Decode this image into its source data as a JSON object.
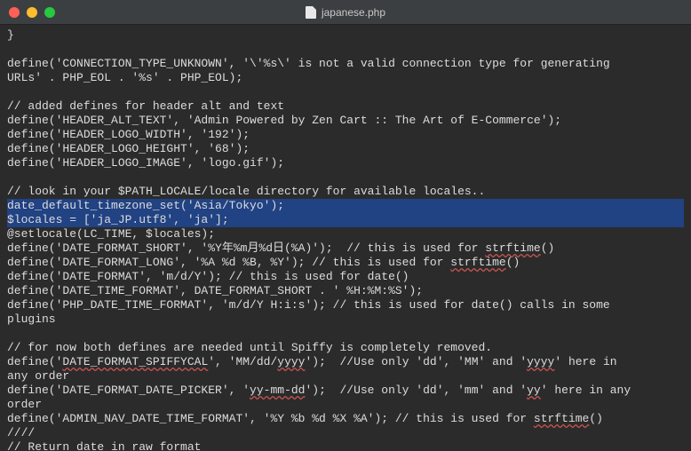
{
  "window": {
    "filename": "japanese.php"
  },
  "code": {
    "lines": [
      {
        "text": "}",
        "hl": false
      },
      {
        "text": "",
        "hl": false
      },
      {
        "text": "define('CONNECTION_TYPE_UNKNOWN', '\\'%s\\' is not a valid connection type for generating",
        "hl": false
      },
      {
        "text": "URLs' . PHP_EOL . '%s' . PHP_EOL);",
        "hl": false
      },
      {
        "text": "",
        "hl": false
      },
      {
        "text": "// added defines for header alt and text",
        "hl": false
      },
      {
        "text": "define('HEADER_ALT_TEXT', 'Admin Powered by Zen Cart :: The Art of E-Commerce');",
        "hl": false
      },
      {
        "text": "define('HEADER_LOGO_WIDTH', '192');",
        "hl": false
      },
      {
        "text": "define('HEADER_LOGO_HEIGHT', '68');",
        "hl": false
      },
      {
        "text": "define('HEADER_LOGO_IMAGE', 'logo.gif');",
        "hl": false
      },
      {
        "text": "",
        "hl": false
      },
      {
        "text": "// look in your $PATH_LOCALE/locale directory for available locales..",
        "hl": false
      },
      {
        "text": "date_default_timezone_set('Asia/Tokyo');",
        "hl": true
      },
      {
        "text": "$locales = ['ja_JP.utf8', 'ja'];",
        "hl": true
      },
      {
        "text": "@setlocale(LC_TIME, $locales);",
        "hl": false
      },
      {
        "segments": [
          {
            "t": "define('DATE_FORMAT_SHORT', '%Y年%m月%d日(%A)');  // this is used for "
          },
          {
            "t": "strftime",
            "sq": true
          },
          {
            "t": "()"
          }
        ],
        "hl": false
      },
      {
        "segments": [
          {
            "t": "define('DATE_FORMAT_LONG', '%A %d %B, %Y'); // this is used for "
          },
          {
            "t": "strftime",
            "sq": true
          },
          {
            "t": "()"
          }
        ],
        "hl": false
      },
      {
        "text": "define('DATE_FORMAT', 'm/d/Y'); // this is used for date()",
        "hl": false
      },
      {
        "text": "define('DATE_TIME_FORMAT', DATE_FORMAT_SHORT . ' %H:%M:%S');",
        "hl": false
      },
      {
        "text": "define('PHP_DATE_TIME_FORMAT', 'm/d/Y H:i:s'); // this is used for date() calls in some",
        "hl": false
      },
      {
        "text": "plugins",
        "hl": false
      },
      {
        "text": "",
        "hl": false
      },
      {
        "text": "// for now both defines are needed until Spiffy is completely removed.",
        "hl": false
      },
      {
        "segments": [
          {
            "t": "define('"
          },
          {
            "t": "DATE_FORMAT_SPIFFYCAL",
            "sq": true
          },
          {
            "t": "', 'MM/dd/"
          },
          {
            "t": "yyyy",
            "sq": true
          },
          {
            "t": "');  //Use only 'dd', 'MM' and '"
          },
          {
            "t": "yyyy",
            "sq": true
          },
          {
            "t": "' here in"
          }
        ],
        "hl": false
      },
      {
        "text": "any order",
        "hl": false
      },
      {
        "segments": [
          {
            "t": "define('DATE_FORMAT_DATE_PICKER', '"
          },
          {
            "t": "yy-mm-dd",
            "sq": true
          },
          {
            "t": "');  //Use only 'dd', 'mm' and '"
          },
          {
            "t": "yy",
            "sq": true
          },
          {
            "t": "' here in any"
          }
        ],
        "hl": false
      },
      {
        "text": "order",
        "hl": false
      },
      {
        "segments": [
          {
            "t": "define('ADMIN_NAV_DATE_TIME_FORMAT', '%Y %b %d %X %A'); // this is used for "
          },
          {
            "t": "strftime",
            "sq": true
          },
          {
            "t": "()"
          }
        ],
        "hl": false
      },
      {
        "text": "////",
        "hl": false
      },
      {
        "text": "// Return date in raw format",
        "hl": false
      }
    ]
  }
}
